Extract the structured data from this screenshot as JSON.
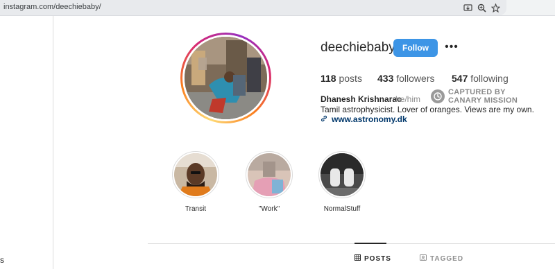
{
  "browser": {
    "url": "instagram.com/deechiebaby/",
    "icons": [
      "install-app-icon",
      "zoom-icon",
      "bookmark-star-icon"
    ]
  },
  "sidebar": {
    "partial_label": "s"
  },
  "profile": {
    "username": "deechiebaby",
    "follow_label": "Follow",
    "more_label": "•••",
    "stats": {
      "posts_count": "118",
      "posts_label": "posts",
      "followers_count": "433",
      "followers_label": "followers",
      "following_count": "547",
      "following_label": "following"
    },
    "full_name": "Dhanesh Krishnarao",
    "pronouns": "he/him",
    "bio": "Tamil astrophysicist. Lover of oranges. Views are my own.",
    "link": "www.astronomy.dk"
  },
  "watermark": {
    "line1": "CAPTURED BY",
    "line2": "CANARY MISSION"
  },
  "highlights": [
    {
      "label": "Transit"
    },
    {
      "label": "\"Work\""
    },
    {
      "label": "NormalStuff"
    }
  ],
  "tabs": {
    "posts": "POSTS",
    "tagged": "TAGGED"
  },
  "colors": {
    "follow_button": "#3d95e6",
    "link": "#00376b",
    "muted": "#8e8e8e"
  }
}
